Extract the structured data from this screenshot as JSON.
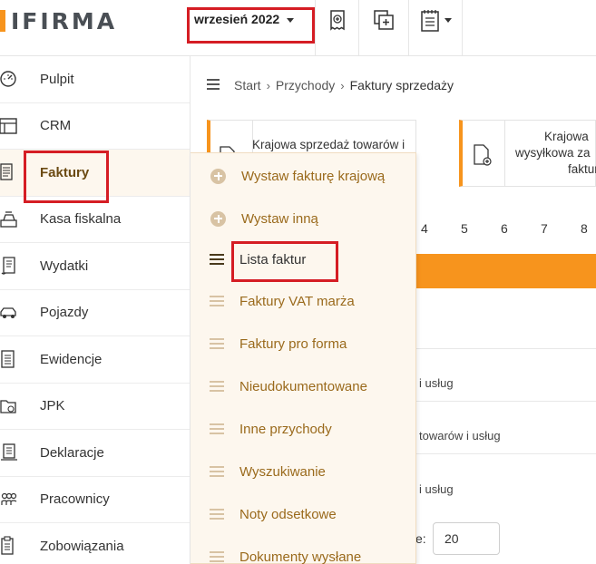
{
  "app": {
    "logo_text": "IFIRMA",
    "brand_color": "#f7941d",
    "highlight_color": "#d51d24"
  },
  "topbar": {
    "month_selector": "wrzesień 2022",
    "icons": [
      "receipt-add-icon",
      "duplicate-add-icon",
      "notepad-dropdown-icon"
    ]
  },
  "sidebar": {
    "items": [
      {
        "label": "Pulpit",
        "icon": "gauge-icon"
      },
      {
        "label": "CRM",
        "icon": "crm-icon"
      },
      {
        "label": "Faktury",
        "icon": "invoice-icon",
        "active": true
      },
      {
        "label": "Kasa fiskalna",
        "icon": "cash-register-icon"
      },
      {
        "label": "Wydatki",
        "icon": "receipt-icon"
      },
      {
        "label": "Pojazdy",
        "icon": "car-icon"
      },
      {
        "label": "Ewidencje",
        "icon": "ledger-icon"
      },
      {
        "label": "JPK",
        "icon": "jpk-folder-icon"
      },
      {
        "label": "Deklaracje",
        "icon": "declaration-icon"
      },
      {
        "label": "Pracownicy",
        "icon": "employees-icon"
      },
      {
        "label": "Zobowiązania",
        "icon": "obligations-icon"
      }
    ]
  },
  "breadcrumb": {
    "items": [
      "Start",
      "Przychody",
      "Faktury sprzedaży"
    ]
  },
  "cards": [
    {
      "text_line1": "Krajowa sprzedaż towarów i"
    },
    {
      "text_line1": "Krajowa",
      "text_line2": "wysyłkowa za",
      "text_line3": "faktur"
    }
  ],
  "pager": {
    "numbers": [
      "4",
      "5",
      "6",
      "7",
      "8"
    ]
  },
  "rows": [
    "i usług",
    "towarów i usług",
    "i usług"
  ],
  "per_page": {
    "label": "e:",
    "value": "20"
  },
  "submenu": {
    "items": [
      {
        "label": "Wystaw fakturę krajową",
        "icon": "plus-circle-icon"
      },
      {
        "label": "Wystaw inną",
        "icon": "plus-circle-icon"
      },
      {
        "label": "Lista faktur",
        "icon": "list-icon",
        "current": true
      },
      {
        "label": "Faktury VAT marża",
        "icon": "list-icon"
      },
      {
        "label": "Faktury pro forma",
        "icon": "list-icon"
      },
      {
        "label": "Nieudokumentowane",
        "icon": "list-icon"
      },
      {
        "label": "Inne przychody",
        "icon": "list-icon"
      },
      {
        "label": "Wyszukiwanie",
        "icon": "list-icon"
      },
      {
        "label": "Noty odsetkowe",
        "icon": "list-icon"
      },
      {
        "label": "Dokumenty wysłane",
        "icon": "list-icon"
      }
    ]
  }
}
